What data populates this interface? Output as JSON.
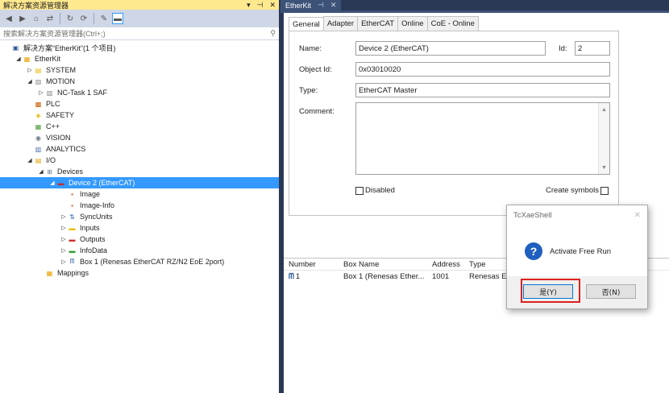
{
  "solution_explorer": {
    "title": "解决方案资源管理器",
    "title_controls": [
      "▾",
      "⊣",
      "✕"
    ],
    "search_placeholder": "搜索解决方案资源管理器(Ctrl+;)",
    "search_icon": "search-icon",
    "tree": [
      {
        "label": "解决方案“EtherKit”(1 个项目)",
        "level": 0,
        "exp": "",
        "icon": "solution-icon",
        "color": "#2b5797"
      },
      {
        "label": "EtherKit",
        "level": 1,
        "exp": "◢",
        "icon": "project-icon",
        "color": "#e8a000"
      },
      {
        "label": "SYSTEM",
        "level": 2,
        "exp": "▷",
        "icon": "system-icon",
        "color": "#e8b800"
      },
      {
        "label": "MOTION",
        "level": 2,
        "exp": "◢",
        "icon": "motion-icon",
        "color": "#8a8a8a"
      },
      {
        "label": "NC-Task 1 SAF",
        "level": 3,
        "exp": "▷",
        "icon": "nc-task-icon",
        "color": "#8a8a8a"
      },
      {
        "label": "PLC",
        "level": 2,
        "exp": "",
        "icon": "plc-icon",
        "color": "#c85a00"
      },
      {
        "label": "SAFETY",
        "level": 2,
        "exp": "",
        "icon": "safety-icon",
        "color": "#e8b800"
      },
      {
        "label": "C++",
        "level": 2,
        "exp": "",
        "icon": "cpp-icon",
        "color": "#4a9a3a"
      },
      {
        "label": "VISION",
        "level": 2,
        "exp": "",
        "icon": "vision-icon",
        "color": "#6a7a8a"
      },
      {
        "label": "ANALYTICS",
        "level": 2,
        "exp": "",
        "icon": "analytics-icon",
        "color": "#4a6aa0"
      },
      {
        "label": "I/O",
        "level": 2,
        "exp": "◢",
        "icon": "io-icon",
        "color": "#e8a000"
      },
      {
        "label": "Devices",
        "level": 3,
        "exp": "◢",
        "icon": "devices-icon",
        "color": "#6a7a8a"
      },
      {
        "label": "Device 2 (EtherCAT)",
        "level": 4,
        "exp": "◢",
        "icon": "ethercat-device-icon",
        "color": "#c03030",
        "selected": true
      },
      {
        "label": "Image",
        "level": 5,
        "exp": "",
        "icon": "image-icon",
        "color": "#e05a20"
      },
      {
        "label": "Image-Info",
        "level": 5,
        "exp": "",
        "icon": "image-info-icon",
        "color": "#e05a20"
      },
      {
        "label": "SyncUnits",
        "level": 5,
        "exp": "▷",
        "icon": "syncunits-icon",
        "color": "#3a6ab0"
      },
      {
        "label": "Inputs",
        "level": 5,
        "exp": "▷",
        "icon": "inputs-icon",
        "color": "#e8c000"
      },
      {
        "label": "Outputs",
        "level": 5,
        "exp": "▷",
        "icon": "outputs-icon",
        "color": "#d03030"
      },
      {
        "label": "InfoData",
        "level": 5,
        "exp": "▷",
        "icon": "infodata-icon",
        "color": "#30a030"
      },
      {
        "label": "Box 1 (Renesas EtherCAT RZ/N2 EoE 2port)",
        "level": 5,
        "exp": "▷",
        "icon": "box-icon",
        "color": "#2b5797"
      },
      {
        "label": "Mappings",
        "level": 3,
        "exp": "",
        "icon": "mappings-icon",
        "color": "#e8a000"
      }
    ]
  },
  "document": {
    "tab_title": "EtherKit",
    "tab_pin": "⊣",
    "tab_close": "✕",
    "tabs": [
      "General",
      "Adapter",
      "EtherCAT",
      "Online",
      "CoE - Online"
    ],
    "active_tab": "General",
    "labels": {
      "name": "Name:",
      "id": "Id:",
      "object_id": "Object Id:",
      "type": "Type:",
      "comment": "Comment:",
      "disabled": "Disabled",
      "create_symbols": "Create symbols"
    },
    "values": {
      "name": "Device 2 (EtherCAT)",
      "id": "2",
      "object_id": "0x03010020",
      "type": "EtherCAT Master",
      "comment": ""
    },
    "list": {
      "headers": [
        "Number",
        "Box Name",
        "Address",
        "Type"
      ],
      "rows": [
        {
          "number": "1",
          "box_name": "Box 1 (Renesas Ether...",
          "address": "1001",
          "type": "Renesas E"
        }
      ]
    }
  },
  "dialog": {
    "title": "TcXaeShell",
    "close": "✕",
    "message": "Activate Free Run",
    "yes": "是(Y)",
    "no": "否(N)"
  }
}
